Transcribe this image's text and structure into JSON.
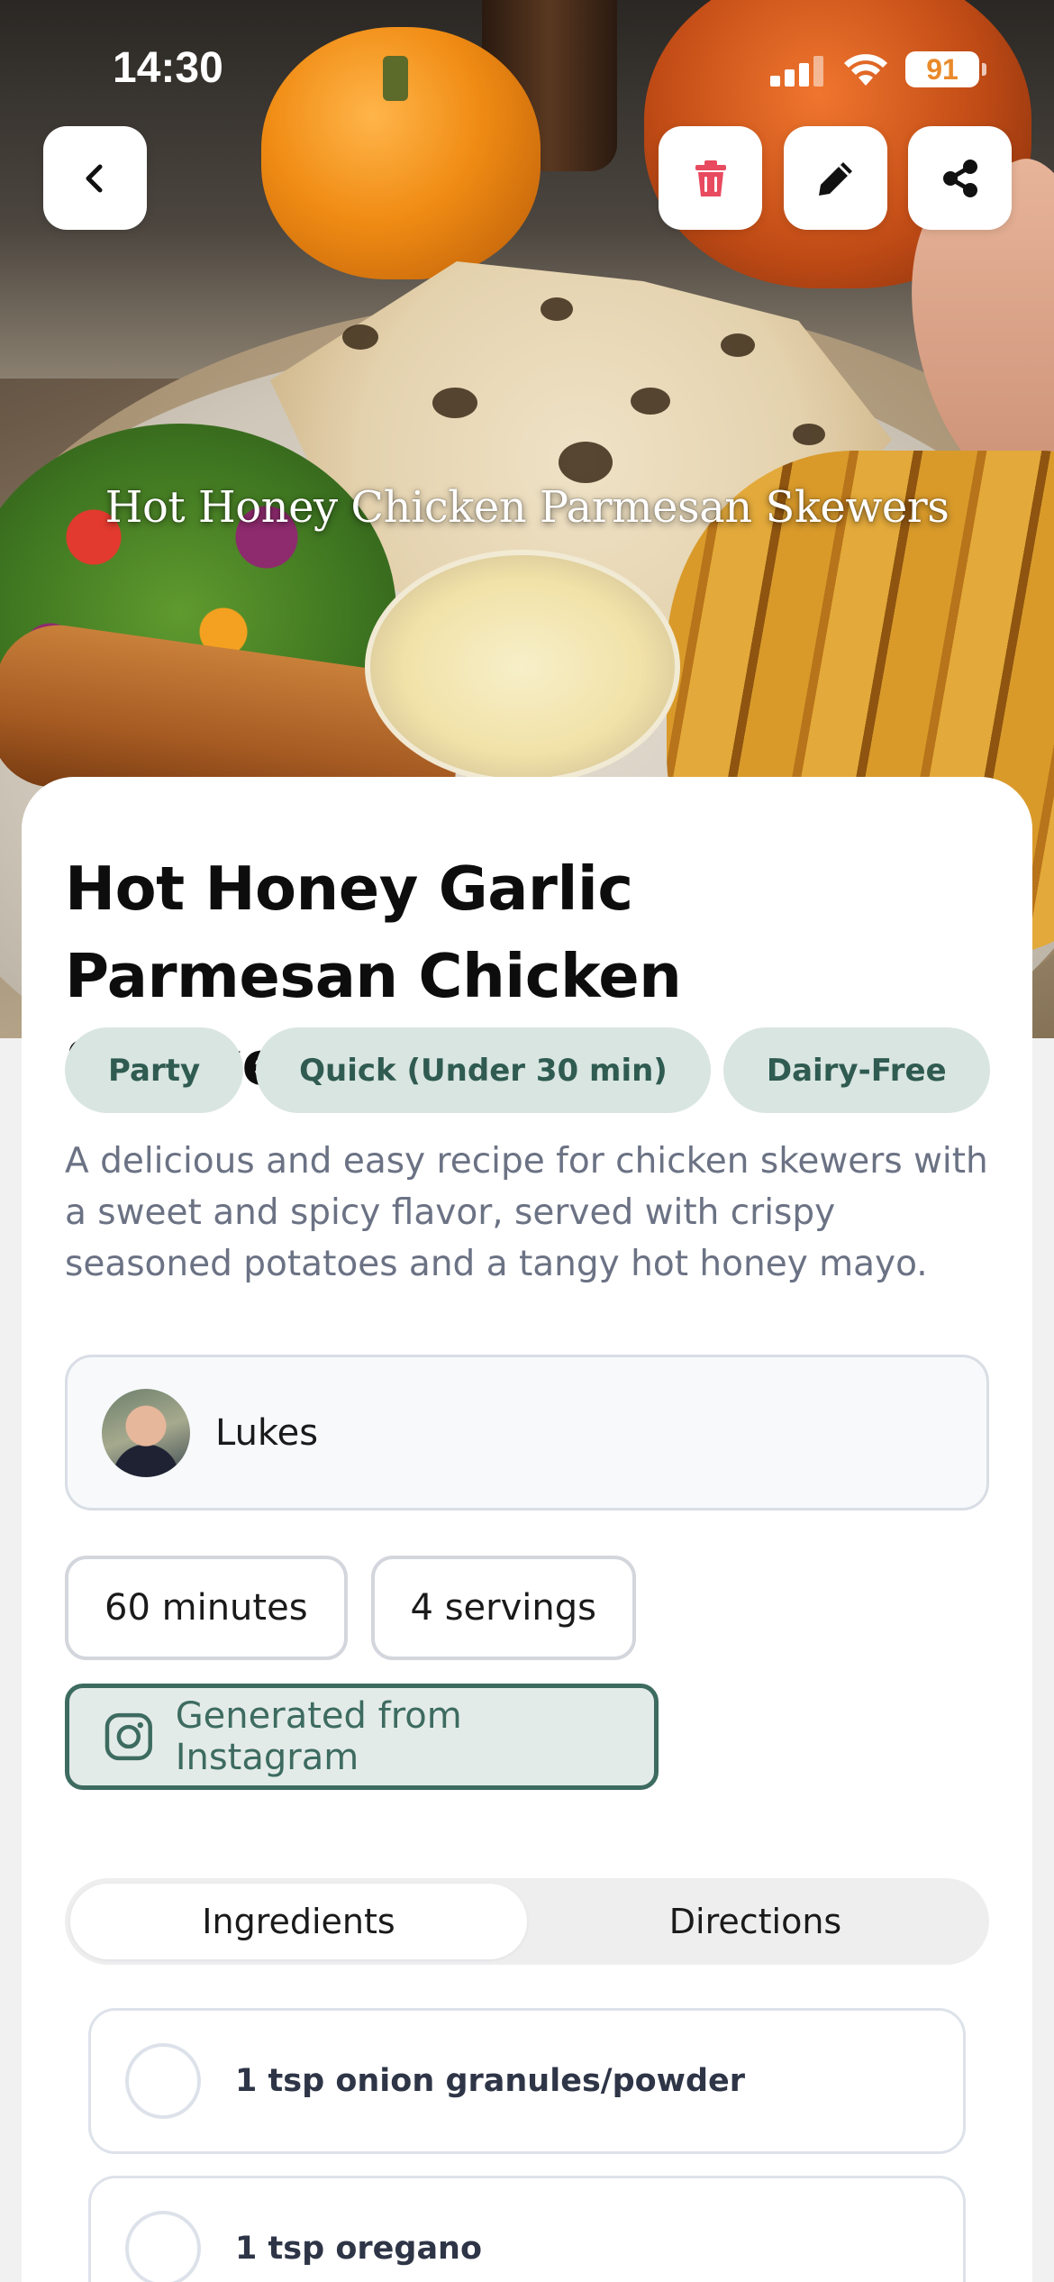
{
  "status_bar": {
    "time": "14:30",
    "battery": "91",
    "icons": [
      "cellular-signal-icon",
      "wifi-icon",
      "battery-icon"
    ]
  },
  "top_actions": {
    "back_icon": "chevron-left-icon",
    "delete_icon": "trash-icon",
    "edit_icon": "pencil-icon",
    "share_icon": "share-icon",
    "delete_color": "#e84a5f"
  },
  "hero": {
    "overlay_title": "Hot Honey Chicken Parmesan Skewers"
  },
  "recipe": {
    "title": "Hot Honey Garlic Parmesan Chicken Skewers",
    "tags": [
      "Party",
      "Quick (Under 30 min)",
      "Dairy-Free"
    ],
    "description": "A delicious and easy recipe for chicken skewers with a sweet and spicy flavor, served with crispy seasoned potatoes and a tangy hot honey mayo."
  },
  "author": {
    "name": "Lukes"
  },
  "meta": {
    "time": "60 minutes",
    "servings": "4 servings"
  },
  "source": {
    "icon": "instagram-icon",
    "label": "Generated from Instagram"
  },
  "tabs": [
    {
      "label": "Ingredients",
      "active": true
    },
    {
      "label": "Directions",
      "active": false
    }
  ],
  "ingredients": [
    {
      "text": "1 tsp onion granules/powder",
      "checked": false
    },
    {
      "text": "1 tsp oregano",
      "checked": false
    }
  ],
  "colors": {
    "accent": "#3d6b60",
    "tag_bg": "#d9e5e1",
    "tag_text": "#2f5b51",
    "description_text": "#6b7284"
  }
}
